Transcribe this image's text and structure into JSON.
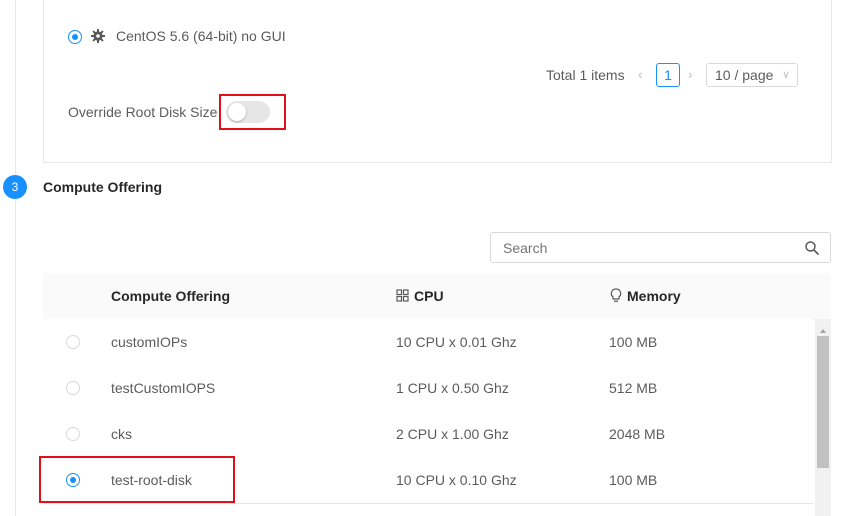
{
  "template": {
    "name": "CentOS 5.6 (64-bit) no GUI",
    "selected": true,
    "pagination": {
      "total": "Total 1 items",
      "current_page": "1",
      "page_size": "10 / page"
    },
    "override_root_disk": {
      "label": "Override Root Disk Size",
      "enabled": false
    }
  },
  "step": {
    "number": "3",
    "title": "Compute Offering"
  },
  "search": {
    "placeholder": "Search"
  },
  "table": {
    "columns": {
      "name": "Compute Offering",
      "cpu": "CPU",
      "memory": "Memory"
    },
    "rows": [
      {
        "name": "customIOPs",
        "cpu": "10 CPU x 0.01 Ghz",
        "memory": "100 MB",
        "selected": false
      },
      {
        "name": "testCustomIOPS",
        "cpu": "1 CPU x 0.50 Ghz",
        "memory": "512 MB",
        "selected": false
      },
      {
        "name": "cks",
        "cpu": "2 CPU x 1.00 Ghz",
        "memory": "2048 MB",
        "selected": false
      },
      {
        "name": "test-root-disk",
        "cpu": "10 CPU x 0.10 Ghz",
        "memory": "100 MB",
        "selected": true
      }
    ]
  },
  "colors": {
    "accent": "#1890ff",
    "highlight": "#e0101b"
  }
}
